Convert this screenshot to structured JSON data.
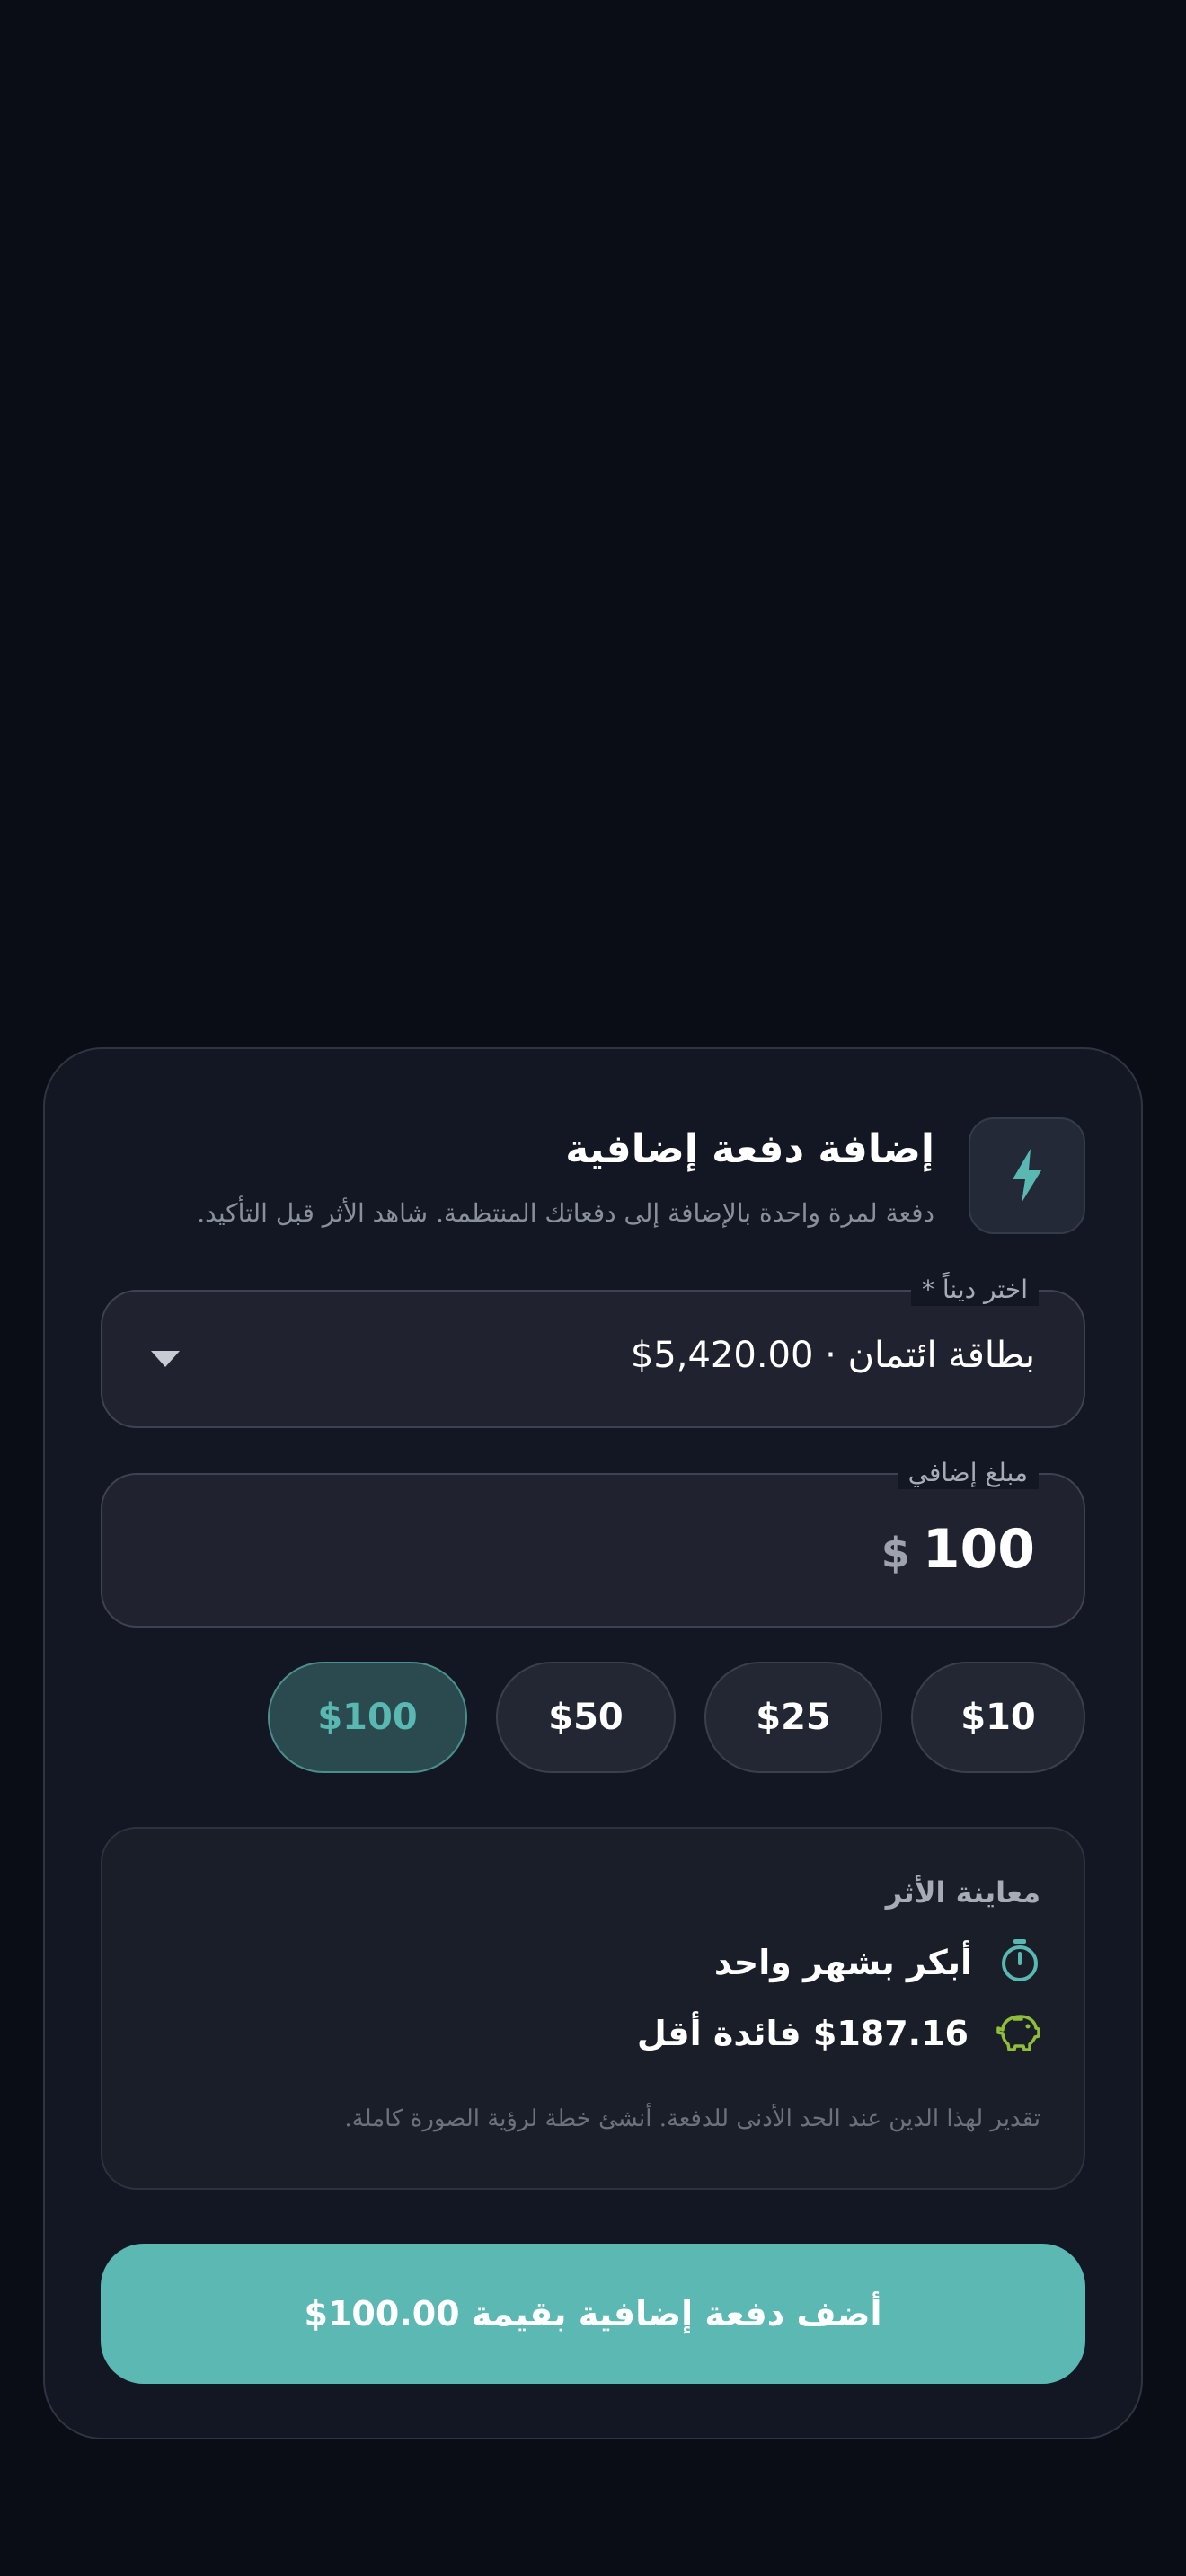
{
  "sheet": {
    "title": "إضافة دفعة إضافية",
    "subtitle": "دفعة لمرة واحدة بالإضافة إلى دفعاتك المنتظمة. شاهد الأثر قبل التأكيد.",
    "header_icon": "lightning-bolt-icon"
  },
  "debt_select": {
    "label": "اختر ديناً *",
    "value": "بطاقة ائتمان · ‎$5,420.00"
  },
  "extra_amount": {
    "label": "مبلغ إضافي",
    "currency": "$",
    "value": "100"
  },
  "quick_amounts": [
    {
      "label": "$10",
      "selected": false
    },
    {
      "label": "$25",
      "selected": false
    },
    {
      "label": "$50",
      "selected": false
    },
    {
      "label": "$100",
      "selected": true
    }
  ],
  "impact": {
    "title": "معاينة الأثر",
    "time_saved": "أبكر بشهر واحد",
    "interest_saved": "$187.16 فائدة أقل",
    "note": "تقدير لهذا الدين عند الحد الأدنى للدفعة. أنشئ خطة لرؤية الصورة كاملة."
  },
  "submit_button": {
    "label": "أضف دفعة إضافية بقيمة ‎$100.00"
  },
  "colors": {
    "background": "#0b0d16",
    "sheet": "#131723",
    "accent": "#5bb8b3",
    "chip_active_text": "#5ab8b2",
    "piggy_icon": "#8fbe3a",
    "timer_icon": "#5ab8b2"
  }
}
